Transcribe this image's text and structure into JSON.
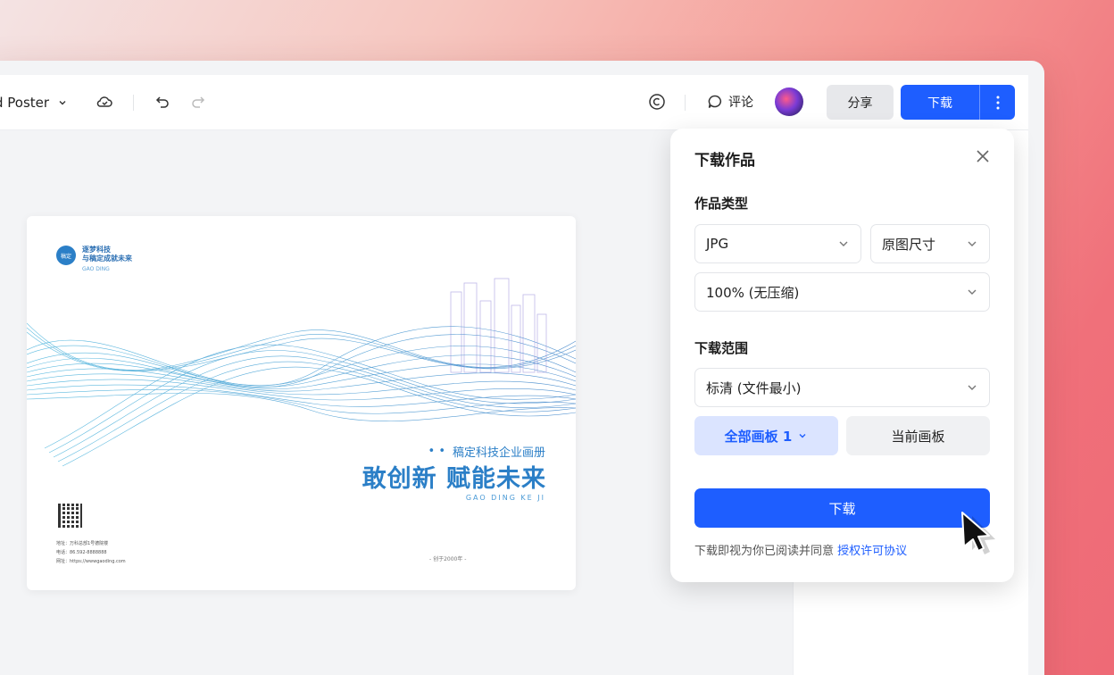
{
  "topbar": {
    "title": "d Poster",
    "comment_label": "评论",
    "share_label": "分享",
    "download_label": "下载"
  },
  "poster": {
    "logo_badge": "稿定",
    "logo_line1": "逐梦科技",
    "logo_line2": "与稿定成就未来",
    "logo_sub": "GAO DING",
    "dots": "• •",
    "subtitle": "稿定科技企业画册",
    "headline": "敢创新 赋能未来",
    "english": "GAO DING KE JI",
    "contact_address": "地址：万科总部1号德院楼",
    "contact_phone": "电话：86.592-8888888",
    "contact_web": "网址：https://wwwgaoding.com",
    "since": "- 创于2000年 -"
  },
  "download_panel": {
    "title": "下载作品",
    "type_label": "作品类型",
    "format_value": "JPG",
    "size_value": "原图尺寸",
    "quality_value": "100% (无压缩)",
    "range_label": "下载范围",
    "clarity_value": "标清 (文件最小)",
    "all_boards_label": "全部画板 1",
    "current_board_label": "当前画板",
    "download_button": "下载",
    "terms_prefix": "下载即视为你已阅读并同意",
    "terms_link": "授权许可协议"
  },
  "colors": {
    "primary": "#1e5eff",
    "poster_accent": "#2b7fc7"
  }
}
